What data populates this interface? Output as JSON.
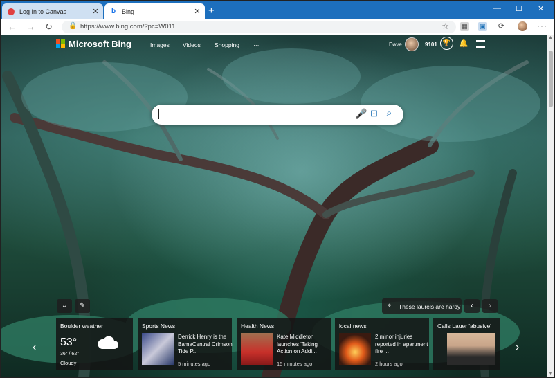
{
  "tabs": [
    {
      "title": "Log In to Canvas",
      "close": "✕"
    },
    {
      "title": "Bing",
      "close": "✕"
    }
  ],
  "new_tab": "+",
  "window_controls": [
    "—",
    "☐",
    "✕"
  ],
  "address_bar": {
    "url": "https://www.bing.com/?pc=W011"
  },
  "header": {
    "brand": "Microsoft Bing",
    "nav": [
      "Images",
      "Videos",
      "Shopping",
      "···"
    ],
    "user_name": "Dave",
    "points": "9101"
  },
  "search": {
    "placeholder": ""
  },
  "image_info": {
    "caption": "These laurels are hardy"
  },
  "cards": {
    "weather": {
      "title": "Boulder weather",
      "temp": "53°",
      "hilo": "36° / 62°",
      "condition": "Cloudy"
    },
    "news": [
      {
        "category": "Sports News",
        "headline": "Derrick Henry is the BamaCentral Crimson Tide P...",
        "time": "5 minutes ago"
      },
      {
        "category": "Health News",
        "headline": "Kate Middleton launches 'Taking Action on Addi...",
        "time": "15 minutes ago"
      },
      {
        "category": "local news",
        "headline": "2 minor injuries reported in apartment fire ...",
        "time": "2 hours ago"
      },
      {
        "category": "Calls Lauer 'abusive'",
        "headline": "",
        "time": ""
      }
    ]
  },
  "colors": {
    "tabbar": "#1d6fbd",
    "accent": "#1a6fb5"
  }
}
